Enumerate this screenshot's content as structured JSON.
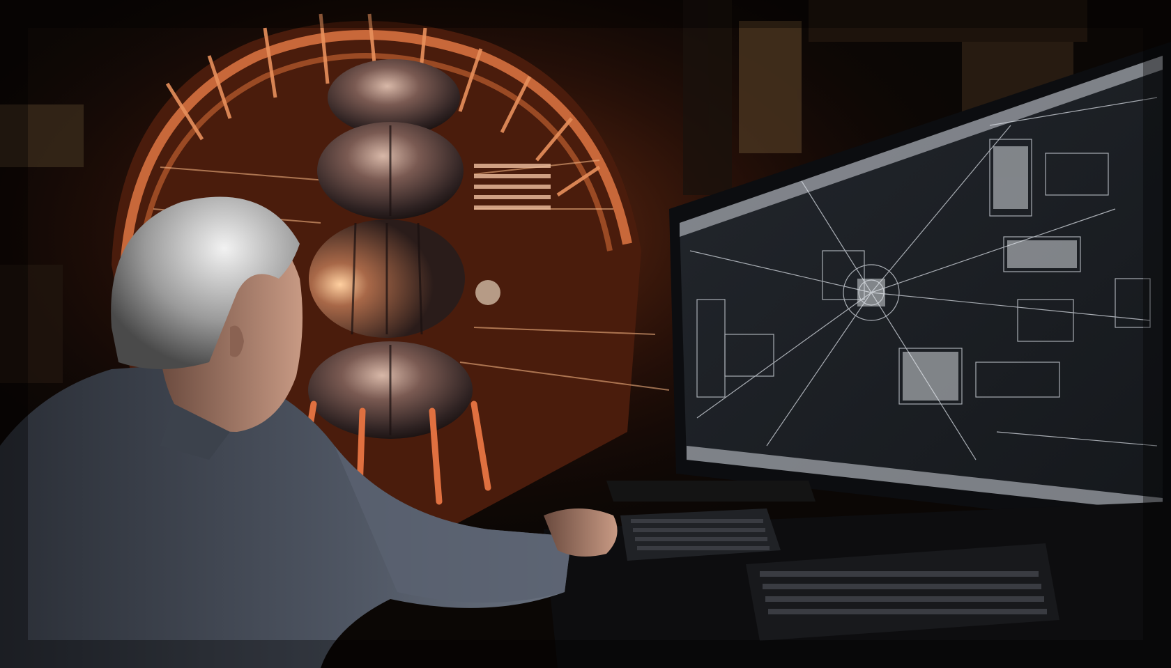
{
  "scene": {
    "palette": {
      "background": "#0d0806",
      "copper": "#c86a3a",
      "copper_highlight": "#f0a070",
      "steel": "#6a6a70",
      "screen_bg": "#1a1d22",
      "screen_lines": "#d8dde4",
      "shirt": "#4a4f5a",
      "hair": "#c8c8c8",
      "skin": "#b88a72"
    },
    "elements": {
      "machine": "copper-reactor-machine",
      "monitor": "monitor-with-schematic",
      "person": "scientist-at-keyboard",
      "keyboard": "keyboard",
      "mouse": "mouse"
    }
  }
}
